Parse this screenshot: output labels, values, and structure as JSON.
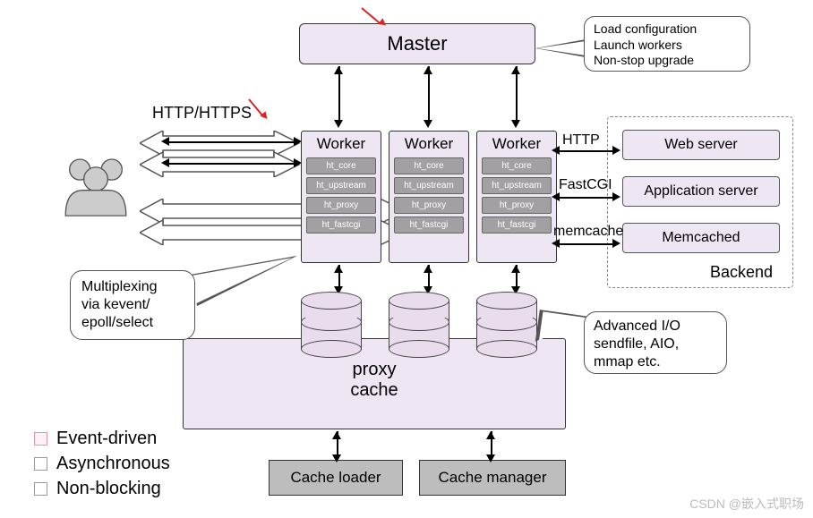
{
  "master": {
    "label": "Master"
  },
  "master_callout": {
    "line1": "Load configuration",
    "line2": "Launch workers",
    "line3": "Non-stop upgrade"
  },
  "labels": {
    "http_https": "HTTP/HTTPS",
    "http": "HTTP",
    "fastcgi": "FastCGI",
    "memcache": "memcache"
  },
  "worker": {
    "title": "Worker",
    "modules": [
      "ht_core",
      "ht_upstream",
      "ht_proxy",
      "ht_fastcgi"
    ]
  },
  "backend": {
    "web": "Web server",
    "app": "Application server",
    "mem": "Memcached",
    "label": "Backend"
  },
  "proxy_cache": {
    "line1": "proxy",
    "line2": "cache"
  },
  "cache_loader": "Cache loader",
  "cache_manager": "Cache manager",
  "mux_callout": {
    "line1": "Multiplexing",
    "line2": "via kevent/",
    "line3": "epoll/select"
  },
  "aio_callout": {
    "line1": "Advanced I/O",
    "line2": "sendfile, AIO,",
    "line3": "mmap etc."
  },
  "legend": {
    "item1": "Event-driven",
    "item2": "Asynchronous",
    "item3": "Non-blocking"
  },
  "watermark": "CSDN @嵌入式职场"
}
